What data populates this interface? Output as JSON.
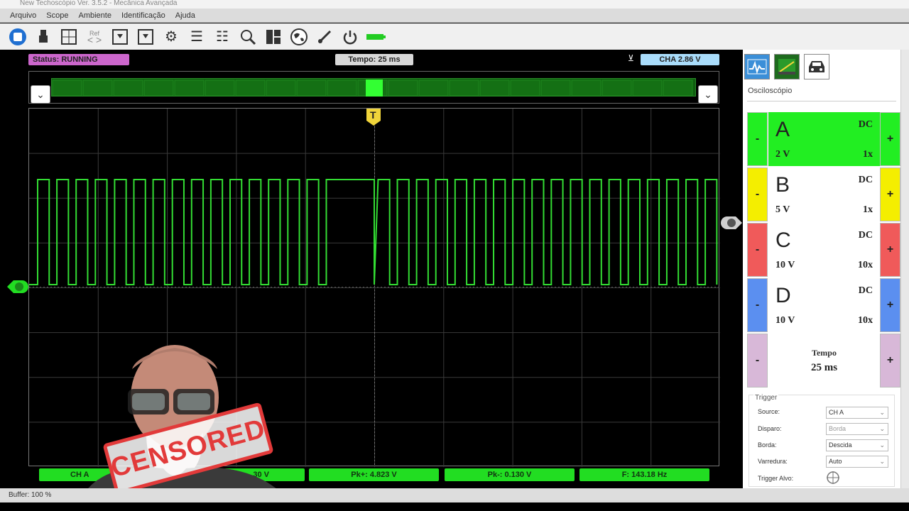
{
  "app": {
    "title": "New Techoscópio Ver. 3.5.2 - Mecânica Avançada"
  },
  "menu": [
    "Arquivo",
    "Scope",
    "Ambiente",
    "Identificação",
    "Ajuda"
  ],
  "toolbar": {
    "icons": [
      "stop-icon",
      "usb-icon",
      "grid-icon",
      "ref-icon",
      "save-icon",
      "load-icon",
      "gear-icon",
      "sliders-icon",
      "sliders-alt-icon",
      "zoom-icon",
      "layout-icon",
      "globe-icon",
      "probe-icon",
      "power-icon",
      "battery-icon"
    ],
    "ref_label": "Ref"
  },
  "scope": {
    "status": "Status: RUNNING",
    "tempo": "Tempo: 25 ms",
    "cha_level": "CHA 2.86 V",
    "trigger_marker": "T",
    "accent_green": "#22dd22",
    "trace_color": "#33dd33"
  },
  "measurements": [
    {
      "label": "CH A",
      "visible": "CH A"
    },
    {
      "label": "...30 V",
      "visible": "30 V"
    },
    {
      "label": "Pk+: 4.823 V",
      "visible": "Pk+: 4.823 V"
    },
    {
      "label": "Pk-: 0.130 V",
      "visible": "Pk-: 0.130 V"
    },
    {
      "label": "F: 143.18 Hz",
      "visible": "F: 143.18 Hz"
    }
  ],
  "right_panel": {
    "section_title": "Osciloscópio",
    "channels": [
      {
        "letter": "A",
        "coupling": "DC",
        "volts": "2 V",
        "mult": "1x",
        "color": "#22ee22"
      },
      {
        "letter": "B",
        "coupling": "DC",
        "volts": "5 V",
        "mult": "1x",
        "color": "#f4ee00"
      },
      {
        "letter": "C",
        "coupling": "DC",
        "volts": "10 V",
        "mult": "10x",
        "color": "#f05a5a"
      },
      {
        "letter": "D",
        "coupling": "DC",
        "volts": "10 V",
        "mult": "10x",
        "color": "#5b8ff0"
      }
    ],
    "tempo": {
      "label": "Tempo",
      "value": "25 ms",
      "color": "#d8b8d8"
    },
    "minus": "-",
    "plus": "+",
    "trigger": {
      "title": "Trigger",
      "source_label": "Source:",
      "source_value": "CH A",
      "disparo_label": "Disparo:",
      "disparo_value": "Borda",
      "borda_label": "Borda:",
      "borda_value": "Descida",
      "varredura_label": "Varredura:",
      "varredura_value": "Auto",
      "alvo_label": "Trigger Alvo:"
    }
  },
  "statusbar": {
    "buffer": "Buffer: 100 %"
  },
  "overlay": {
    "stamp_text": "CENSORED"
  }
}
